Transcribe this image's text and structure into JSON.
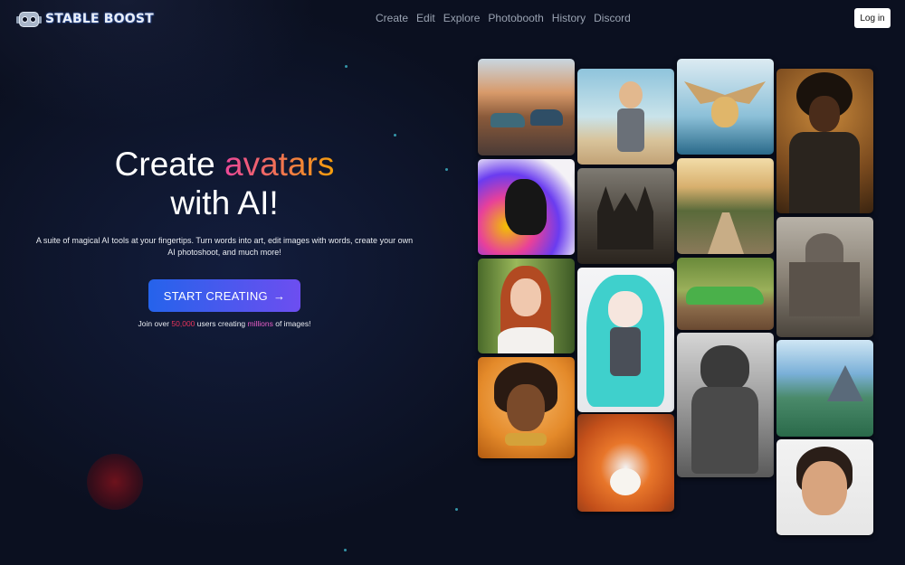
{
  "brand": {
    "name": "STABLE BOOST",
    "logo_icon": "robot-icon"
  },
  "nav": {
    "items": [
      "Create",
      "Edit",
      "Explore",
      "Photobooth",
      "History",
      "Discord"
    ]
  },
  "header": {
    "login_label": "Log in"
  },
  "hero": {
    "title_before": "Create ",
    "title_accent": "avatars",
    "title_line2": "with AI!",
    "subtitle": "A suite of magical AI tools at your fingertips. Turn words into art, edit images with words, create your own AI photoshoot, and much more!",
    "cta_label": "START CREATING",
    "cta_icon": "arrow-right-icon",
    "join_prefix": "Join over ",
    "join_count": "50,000",
    "join_middle": " users creating ",
    "join_highlight": "millions",
    "join_suffix": " of images!"
  },
  "colors": {
    "background": "#0b1020",
    "cta_gradient_start": "#2563eb",
    "cta_gradient_end": "#6d4ef0",
    "accent_pink": "#ec4899",
    "accent_orange": "#f59e0b"
  },
  "gallery": {
    "tiles": [
      "vintage-cars-street-image",
      "black-dog-colorful-image",
      "red-haired-woman-image",
      "african-queen-portrait-image",
      "robot-boy-image",
      "dark-castle-image",
      "anime-girl-image",
      "fox-portrait-image",
      "flying-dog-image",
      "forest-road-image",
      "green-car-image",
      "armored-warrior-image",
      "golden-suit-man-image",
      "ruined-capitol-image",
      "fantasy-landscape-image",
      "smiling-woman-portrait-image"
    ]
  }
}
